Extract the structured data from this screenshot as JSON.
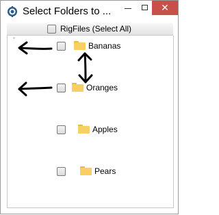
{
  "window": {
    "title": "Select Folders to ...",
    "close_glyph": "✕"
  },
  "header": {
    "select_all_label": "RigFiles (Select All)"
  },
  "tree": {
    "items": [
      {
        "label": "Bananas"
      },
      {
        "label": "Oranges"
      },
      {
        "label": "Apples"
      },
      {
        "label": "Pears"
      }
    ]
  },
  "colors": {
    "folder": "#f7cf63",
    "close_button": "#c7504a",
    "annotation": "#000000"
  },
  "icons": [
    "app-icon",
    "minimize-icon",
    "maximize-icon",
    "close-icon",
    "folder-icon",
    "arrow-left-annotation",
    "double-arrow-annotation"
  ]
}
